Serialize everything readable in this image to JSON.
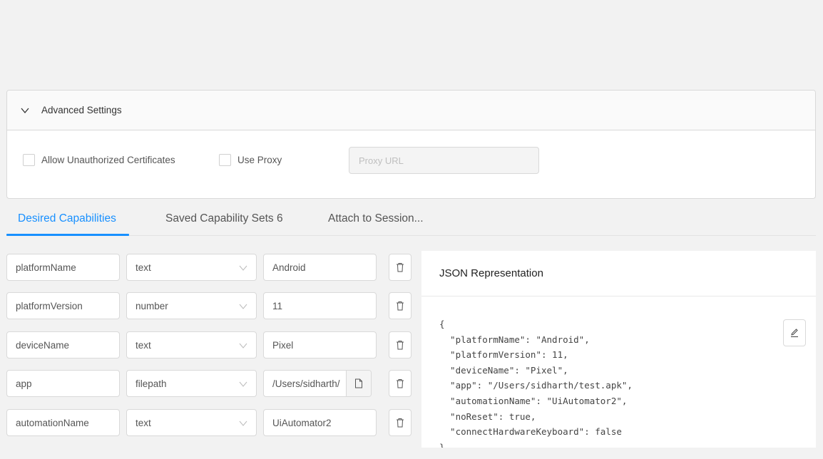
{
  "advanced": {
    "title": "Advanced Settings",
    "allow_unauthorized_label": "Allow Unauthorized Certificates",
    "allow_unauthorized_checked": false,
    "use_proxy_label": "Use Proxy",
    "use_proxy_checked": false,
    "proxy_placeholder": "Proxy URL"
  },
  "tabs": [
    {
      "label": "Desired Capabilities",
      "active": true
    },
    {
      "label": "Saved Capability Sets 6",
      "active": false
    },
    {
      "label": "Attach to Session...",
      "active": false
    }
  ],
  "capabilities": [
    {
      "name": "platformName",
      "type": "text",
      "value": "Android"
    },
    {
      "name": "platformVersion",
      "type": "number",
      "value": "11"
    },
    {
      "name": "deviceName",
      "type": "text",
      "value": "Pixel"
    },
    {
      "name": "app",
      "type": "filepath",
      "value": "/Users/sidharth/"
    },
    {
      "name": "automationName",
      "type": "text",
      "value": "UiAutomator2"
    }
  ],
  "json_panel": {
    "title": "JSON Representation",
    "text": "{\n  \"platformName\": \"Android\",\n  \"platformVersion\": 11,\n  \"deviceName\": \"Pixel\",\n  \"app\": \"/Users/sidharth/test.apk\",\n  \"automationName\": \"UiAutomator2\",\n  \"noReset\": true,\n  \"connectHardwareKeyboard\": false\n}"
  },
  "colors": {
    "accent": "#1890ff",
    "background": "#f2f2f2",
    "border": "#d9d9d9"
  }
}
